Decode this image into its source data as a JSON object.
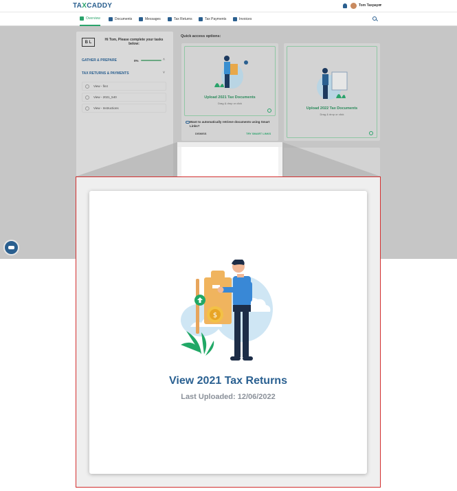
{
  "app": {
    "logo_prefix": "TA",
    "logo_x": "X",
    "logo_suffix": "CADDY",
    "user_name": "Tom Taxpayer"
  },
  "nav": {
    "items": [
      {
        "label": "Overview"
      },
      {
        "label": "Documents"
      },
      {
        "label": "Messages"
      },
      {
        "label": "Tax Returns"
      },
      {
        "label": "Tax Payments"
      },
      {
        "label": "Invoices"
      }
    ]
  },
  "sidebar": {
    "logo_text": "B L",
    "greeting": "Hi Tom, Please complete your tasks below:",
    "gather_label": "GATHER & PREPARE",
    "gather_progress": "0%",
    "returns_label": "TAX RETURNS & PAYMENTS",
    "items": [
      {
        "label": "View - fin4"
      },
      {
        "label": "View - 2021_540"
      },
      {
        "label": "View - Instructions"
      }
    ]
  },
  "quick_access": {
    "title": "Quick access options:",
    "card1": {
      "title": "Upload 2021 Tax Documents",
      "subtitle": "Drag & drop or click"
    },
    "card2": {
      "title": "Upload 2022 Tax Documents",
      "subtitle": "Drag & drop or click"
    },
    "smart_links_text": "Want to automatically retrieve documents using Smart Links?",
    "dismiss_label": "DISMISS",
    "try_label": "TRY SMART LINKS"
  },
  "zoom_card": {
    "title": "View 2021 Tax Returns",
    "subtitle": "Last Uploaded: 12/06/2022"
  },
  "colors": {
    "brand_blue": "#2a5f8f",
    "brand_green": "#2aa36b",
    "highlight_border": "#d22d2d"
  }
}
